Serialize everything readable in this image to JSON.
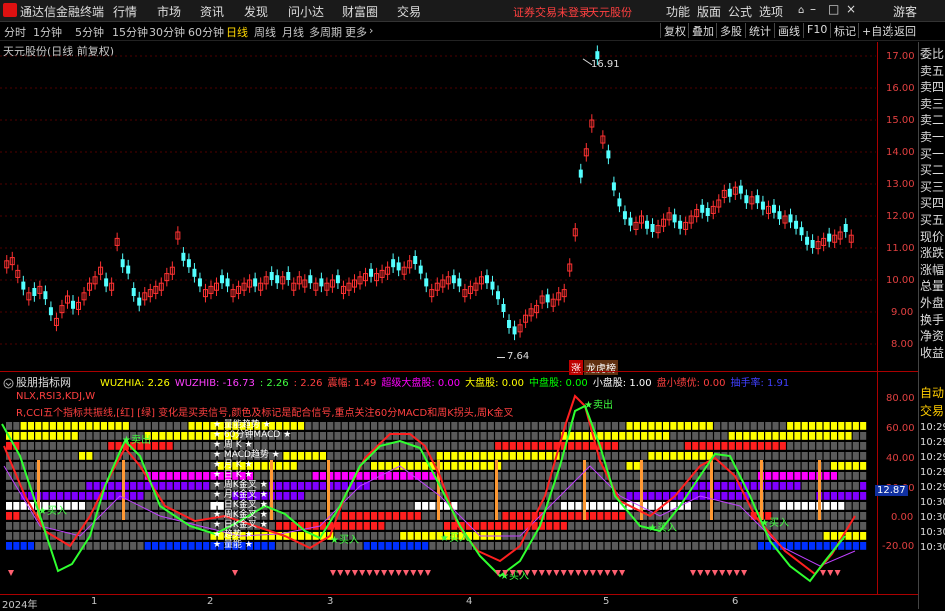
{
  "titlebar": {
    "app_name": "通达信金融终端",
    "menus": [
      "行情",
      "市场",
      "资讯",
      "发现",
      "问小达",
      "财富圈",
      "交易"
    ],
    "notice": "证券交易未登录",
    "stock": "天元股份",
    "right_menus": [
      "功能",
      "版面",
      "公式",
      "选项"
    ],
    "guest": "游客"
  },
  "toolbar": {
    "periods": [
      "分时",
      "1分钟",
      "5分钟",
      "15分钟",
      "30分钟",
      "60分钟",
      "日线",
      "周线",
      "月线",
      "多周期",
      "更多"
    ],
    "selected": "日线",
    "buttons": [
      "复权",
      "叠加",
      "多股",
      "统计",
      "画线",
      "F10",
      "标记",
      "+自选",
      "返回"
    ]
  },
  "main_chart": {
    "title": "天元股份(日线 前复权)",
    "high_label": "16.91",
    "low_label": "7.64",
    "badge_zhang": "涨",
    "badge_rank": "龙虎榜",
    "price_axis": [
      "17.00",
      "16.00",
      "15.00",
      "14.00",
      "13.00",
      "12.00",
      "11.00",
      "10.00",
      "9.00",
      "8.00"
    ]
  },
  "indicator": {
    "name": "股朋指标网",
    "values": [
      {
        "label": "WUZHIA: 2.26",
        "color": "#ffff00"
      },
      {
        "label": "WUZHIB: -16.73",
        "color": "#ff40ff"
      },
      {
        "label": ": 2.26",
        "color": "#40ff40"
      },
      {
        "label": ": 2.26",
        "color": "#ff4040"
      },
      {
        "label": "震幅: 1.49",
        "color": "#ff4040"
      },
      {
        "label": "超级大盘股: 0.00",
        "color": "#ff00ff"
      },
      {
        "label": "大盘股: 0.00",
        "color": "#ffff00"
      },
      {
        "label": "中盘股: 0.00",
        "color": "#00ff00"
      },
      {
        "label": "小盘股: 1.00",
        "color": "#ffffff"
      },
      {
        "label": "盘小绩优: 0.00",
        "color": "#ff4040"
      },
      {
        "label": "抽手率: 1.91",
        "color": "#4040ff"
      }
    ],
    "line1": "NLX,RSI3,KDJ,W",
    "line2": "R,CCI五个指标共振线,[红] [绿] 变化是买卖信号,颜色及标记是配合信号,重点关注60分MACD和周K拐头,周K金叉",
    "center_labels": [
      "★ 量能趋势 ★",
      "★ 60分钟MACD ★",
      "★ 周 K ★",
      "★ MACD趋势 ★",
      "★ 月 K ★",
      "★ 日 K ★",
      "★ 周K金叉 ★",
      "★ 月K金叉 ★",
      "★ 日K金叉 ★",
      "★ 周K金叉 ★",
      "★ 日K金叉 ★",
      "★ 趋势 ★",
      "★ 量能 ★"
    ],
    "axis": [
      "80.00",
      "60.00",
      "40.00",
      "20.00",
      "0.00",
      "-20.00"
    ],
    "badge_value": "12.87",
    "signals": [
      {
        "text": "★卖出",
        "color": "#40ff40"
      },
      {
        "text": "★买入",
        "color": "#40ff40"
      },
      {
        "text": "★卖出",
        "color": "#40ff40"
      },
      {
        "text": "★买入",
        "color": "#40ff40"
      },
      {
        "text": "★买入",
        "color": "#40ff40"
      },
      {
        "text": "★买入",
        "color": "#40ff40"
      },
      {
        "text": "★买入",
        "color": "#40ff40"
      },
      {
        "text": "★买入",
        "color": "#40ff40"
      }
    ]
  },
  "right_panel": {
    "items_top": [
      "委比",
      "卖五",
      "卖四",
      "卖三",
      "卖二",
      "卖一",
      "买一",
      "买二",
      "买三",
      "买四",
      "买五",
      "现价",
      "涨跌",
      "涨幅",
      "总量",
      "外盘",
      "换手",
      "净资",
      "收益"
    ],
    "items_bottom": [
      "自动",
      "交易"
    ],
    "times": [
      "10:29",
      "10:29",
      "10:29",
      "10:29",
      "10:29",
      "10:30",
      "10:30",
      "10:30",
      "10:30"
    ]
  },
  "date_axis": [
    "2024年",
    "1",
    "2",
    "3",
    "4",
    "5",
    "6"
  ]
}
